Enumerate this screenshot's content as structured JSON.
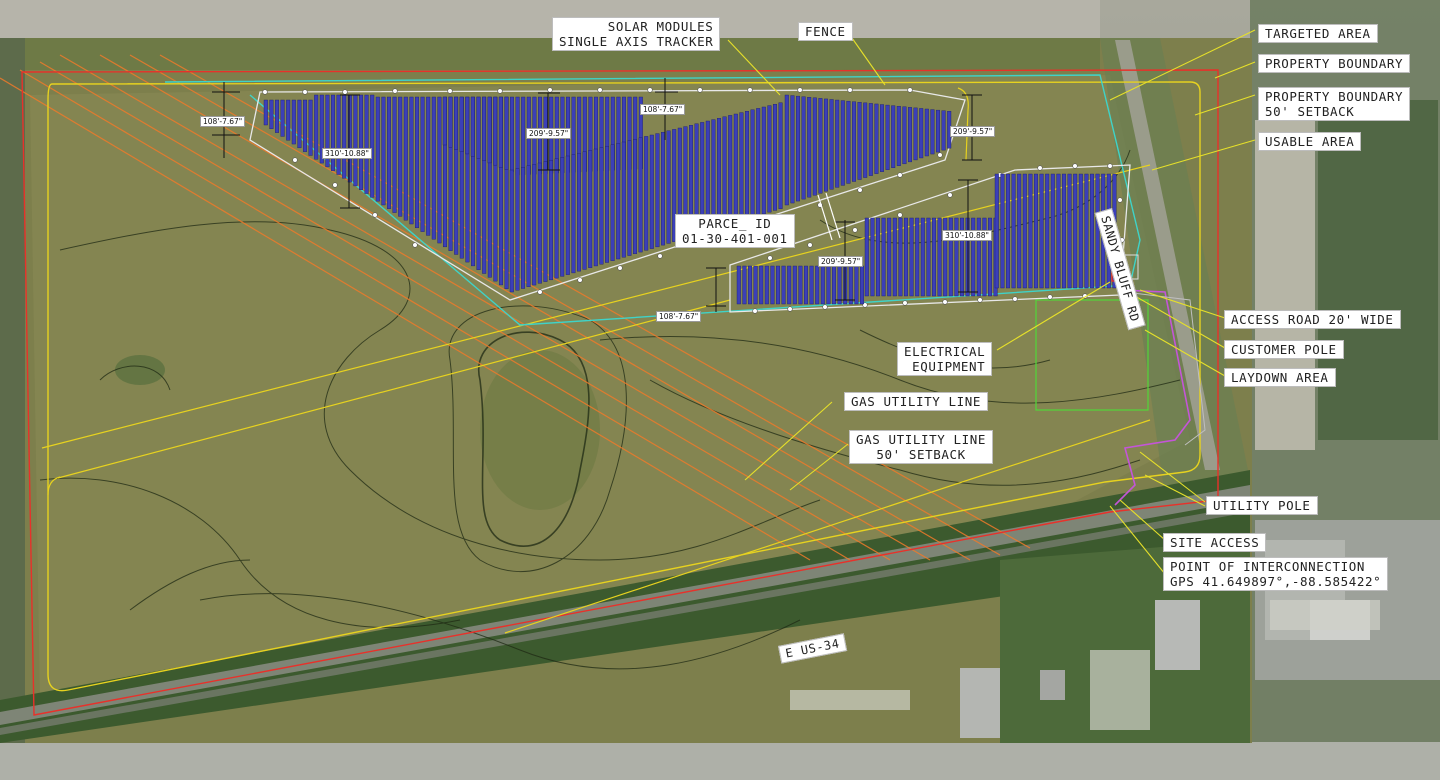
{
  "labels": {
    "solar_modules": "SOLAR MODULES\nSINGLE AXIS TRACKER",
    "fence": "FENCE",
    "targeted_area": "TARGETED AREA",
    "property_boundary": "PROPERTY BOUNDARY",
    "property_boundary_setback": "PROPERTY BOUNDARY\n50' SETBACK",
    "usable_area": "USABLE AREA",
    "parcel_id": "PARCE_ ID\n01-30-401-001",
    "electrical_equipment": "ELECTRICAL\nEQUIPMENT",
    "gas_utility_line": "GAS UTILITY LINE",
    "gas_utility_line_setback": "GAS UTILITY LINE\n50' SETBACK",
    "access_road": "ACCESS ROAD 20' WIDE",
    "customer_pole": "CUSTOMER POLE",
    "laydown_area": "LAYDOWN AREA",
    "utility_pole": "UTILITY POLE",
    "site_access": "SITE ACCESS",
    "point_of_interconnection": "POINT OF INTERCONNECTION\nGPS 41.649897°,-88.585422°"
  },
  "roads": {
    "sandy_bluff": "SANDY BLUFF RD",
    "us34": "E US-34"
  },
  "dimensions": {
    "d1": "108'-7.67\"",
    "d2": "310'-10.88\"",
    "d3": "108'-7.67\"",
    "d4": "209'-9.57\"",
    "d5": "209'-9.57\"",
    "d6": "310'-10.88\"",
    "d7": "209'-9.57\"",
    "d8": "108'-7.67\""
  },
  "colors": {
    "property_boundary": "#e8312a",
    "setback": "#e7d21f",
    "targeted_area": "#3fd3c8",
    "fence": "#e8e8e8",
    "solar_modules": "#3b3fb8",
    "gas_line": "#f07a2a",
    "laydown": "#55d13b",
    "access_road": "#c455d8",
    "leader": "#e6e02a"
  }
}
